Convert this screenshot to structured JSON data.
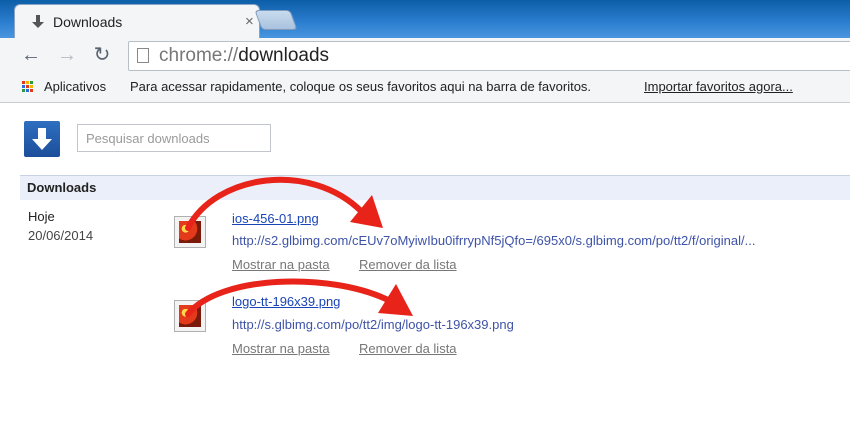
{
  "tab": {
    "title": "Downloads",
    "close_glyph": "×"
  },
  "nav": {
    "back_glyph": "←",
    "forward_glyph": "→",
    "reload_glyph": "↻"
  },
  "omnibox": {
    "scheme": "chrome://",
    "path": "downloads"
  },
  "bookmarks": {
    "apps_label": "Aplicativos",
    "hint": "Para acessar rapidamente, coloque os seus favoritos aqui na barra de favoritos.",
    "import_link": "Importar favoritos agora..."
  },
  "search": {
    "placeholder": "Pesquisar downloads",
    "value": ""
  },
  "section": {
    "title": "Downloads"
  },
  "date_group": {
    "day": "Hoje",
    "date": "20/06/2014"
  },
  "downloads": [
    {
      "file_name": "ios-456-01.png",
      "url": "http://s2.glbimg.com/cEUv7oMyiwIbu0ifrrypNf5jQfo=/695x0/s.glbimg.com/po/tt2/f/original/...",
      "show_in_folder": "Mostrar na pasta",
      "remove": "Remover da lista"
    },
    {
      "file_name": "logo-tt-196x39.png",
      "url": "http://s.glbimg.com/po/tt2/img/logo-tt-196x39.png",
      "show_in_folder": "Mostrar na pasta",
      "remove": "Remover da lista"
    }
  ],
  "colors": {
    "accent": "#1a45b8",
    "annotation_arrow": "#e8231a",
    "header_bg": "#ebeff9"
  },
  "icons": [
    "download-tab-icon",
    "apps-grid-icon",
    "page-icon",
    "downloads-logo-icon",
    "file-thumbnail-icon"
  ]
}
